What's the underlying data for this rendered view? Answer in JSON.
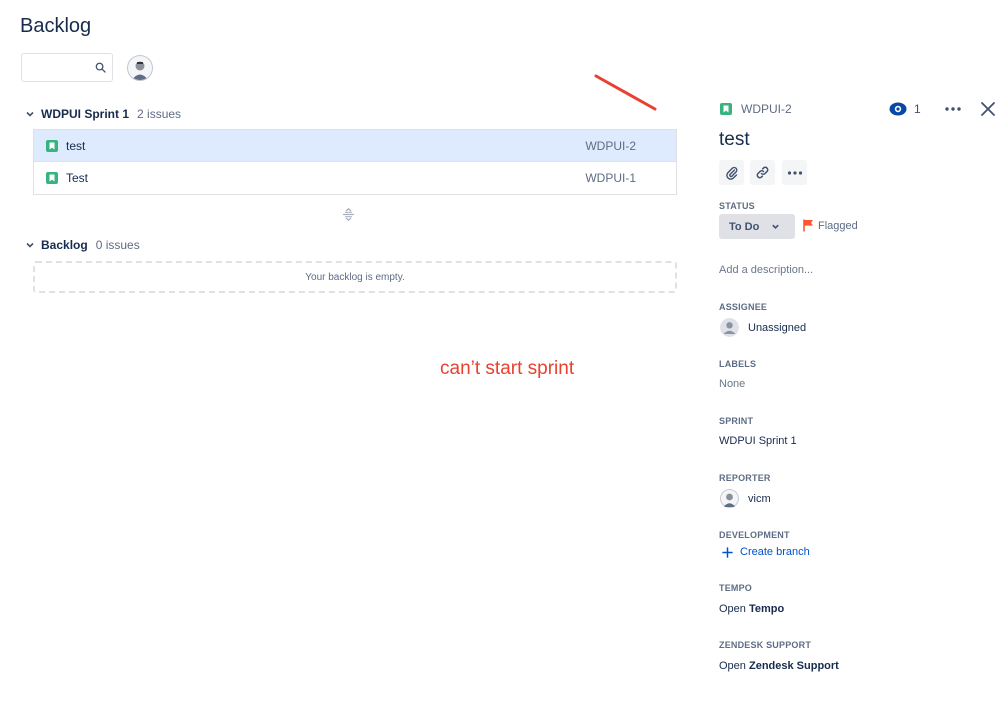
{
  "page": {
    "title": "Backlog",
    "search_value": ""
  },
  "sprint": {
    "name": "WDPUI Sprint 1",
    "count_label": "2 issues",
    "issues": [
      {
        "summary": "test",
        "key": "WDPUI-2",
        "selected": true
      },
      {
        "summary": "Test",
        "key": "WDPUI-1",
        "selected": false
      }
    ]
  },
  "backlog": {
    "name": "Backlog",
    "count_label": "0 issues",
    "empty_text": "Your backlog is empty."
  },
  "annotation": {
    "text": "can’t start sprint",
    "color": "#e8412f"
  },
  "detail": {
    "key": "WDPUI-2",
    "watch_count": "1",
    "title": "test",
    "status_label": "STATUS",
    "status_value": "To Do",
    "flag_label": "Flagged",
    "description_placeholder": "Add a description...",
    "assignee_label": "ASSIGNEE",
    "assignee_value": "Unassigned",
    "labels_label": "LABELS",
    "labels_value": "None",
    "sprint_label": "SPRINT",
    "sprint_value": "WDPUI Sprint 1",
    "reporter_label": "REPORTER",
    "reporter_value": "vicm",
    "development_label": "DEVELOPMENT",
    "create_branch_label": "Create branch",
    "tempo_label": "TEMPO",
    "tempo_prefix": "Open",
    "tempo_link": "Tempo",
    "zendesk_label": "ZENDESK SUPPORT",
    "zendesk_prefix": "Open",
    "zendesk_link": "Zendesk Support"
  },
  "colors": {
    "story_green": "#36b37e",
    "flag_red": "#ff5630",
    "link_blue": "#0052cc",
    "selected_row": "#deebff"
  },
  "icons": {
    "issue_type": "story-icon",
    "watch": "eye-icon",
    "attach": "paperclip-icon",
    "link": "link-icon",
    "more": "more-icon",
    "close": "close-icon",
    "flag": "flag-icon",
    "add": "plus-icon"
  }
}
